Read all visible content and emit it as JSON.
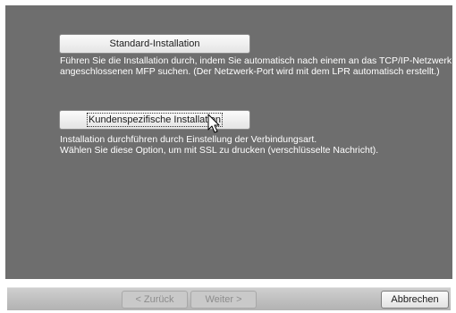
{
  "options": {
    "standard": {
      "label": "Standard-Installation",
      "description_line1": "Führen Sie die Installation durch, indem Sie automatisch nach einem an das TCP/IP-Netzwerk",
      "description_line2": "angeschlossenen MFP suchen. (Der Netzwerk-Port wird mit dem LPR automatisch erstellt.)"
    },
    "custom": {
      "label": "Kundenspezifische Installation",
      "description_line1": "Installation durchführen durch Einstellung der Verbindungsart.",
      "description_line2": "Wählen Sie diese Option, um mit SSL zu drucken (verschlüsselte Nachricht)."
    }
  },
  "footer": {
    "back_label": "< Zurück",
    "next_label": "Weiter >",
    "cancel_label": "Abbrechen"
  },
  "icons": {
    "cursor": "arrow-cursor-icon"
  },
  "colors": {
    "panel": "#6e6e6e",
    "text_on_panel": "#ffffff",
    "disabled_text": "#8c8c8c"
  }
}
